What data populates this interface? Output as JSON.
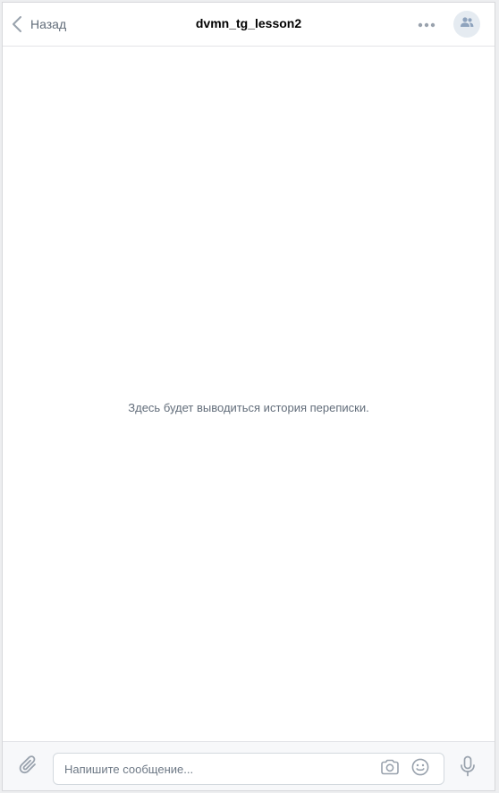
{
  "header": {
    "back_label": "Назад",
    "title": "dvmn_tg_lesson2"
  },
  "history": {
    "empty_text": "Здесь будет выводиться история переписки."
  },
  "composer": {
    "placeholder": "Напишите сообщение..."
  },
  "icons": {
    "back": "chevron-left-icon",
    "more": "more-dots-icon",
    "avatar": "group-people-icon",
    "attach": "paperclip-icon",
    "camera": "camera-icon",
    "emoji": "smile-icon",
    "mic": "microphone-icon"
  },
  "colors": {
    "icon": "#99a2ad",
    "avatar_bg": "#e5ebf1",
    "avatar_icon": "#8ea3bd",
    "secondary_text": "#626d7a",
    "divider": "#e3e4e8"
  }
}
